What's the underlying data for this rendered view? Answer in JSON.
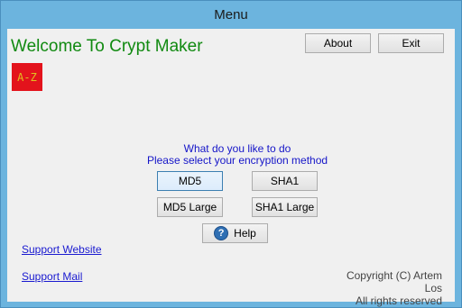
{
  "window": {
    "title": "Menu"
  },
  "header": {
    "welcome_text": "Welcome To Crypt Maker",
    "logo_text": "A-Z"
  },
  "toolbar": {
    "about_label": "About",
    "exit_label": "Exit"
  },
  "prompt": {
    "line1": "What do you like to do",
    "line2": "Please select your encryption method"
  },
  "methods": {
    "md5": "MD5",
    "sha1": "SHA1",
    "md5_large": "MD5 Large",
    "sha1_large": "SHA1 Large"
  },
  "help": {
    "label": "Help",
    "icon": "help-icon"
  },
  "links": {
    "support_website": "Support Website",
    "support_mail": "Support Mail"
  },
  "footer": {
    "copyright": "Copyright (C) Artem Los",
    "rights": "All rights reserved"
  },
  "colors": {
    "welcome_text": "#118a11",
    "prompt_text": "#1515c8",
    "logo_background": "#e3131c",
    "logo_text": "#e0c020"
  }
}
